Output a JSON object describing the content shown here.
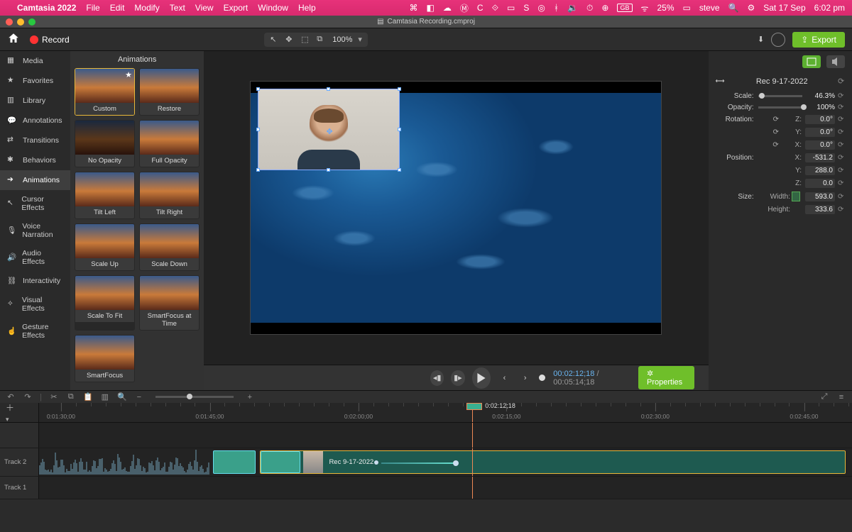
{
  "menubar": {
    "app": "Camtasia 2022",
    "items": [
      "File",
      "Edit",
      "Modify",
      "Text",
      "View",
      "Export",
      "Window",
      "Help"
    ],
    "right": {
      "battery": "25%",
      "user": "steve",
      "date": "Sat 17 Sep",
      "time": "6:02 pm"
    }
  },
  "window": {
    "title": "Camtasia Recording.cmproj"
  },
  "toolbar": {
    "record_label": "Record",
    "zoom": "100%",
    "export_label": "Export"
  },
  "rail": {
    "items": [
      {
        "label": "Media",
        "icon": "film-icon"
      },
      {
        "label": "Favorites",
        "icon": "star-icon"
      },
      {
        "label": "Library",
        "icon": "books-icon"
      },
      {
        "label": "Annotations",
        "icon": "speech-icon"
      },
      {
        "label": "Transitions",
        "icon": "transition-icon"
      },
      {
        "label": "Behaviors",
        "icon": "atom-icon"
      },
      {
        "label": "Animations",
        "icon": "arrow-icon",
        "selected": true
      },
      {
        "label": "Cursor Effects",
        "icon": "cursor-fx-icon"
      },
      {
        "label": "Voice Narration",
        "icon": "mic-icon"
      },
      {
        "label": "Audio Effects",
        "icon": "speaker-icon"
      },
      {
        "label": "Interactivity",
        "icon": "chain-icon"
      },
      {
        "label": "Visual Effects",
        "icon": "magic-icon"
      },
      {
        "label": "Gesture Effects",
        "icon": "hand-icon"
      }
    ]
  },
  "anim_panel": {
    "title": "Animations",
    "tiles": [
      {
        "label": "Custom",
        "selected": true,
        "star": true
      },
      {
        "label": "Restore"
      },
      {
        "label": "No Opacity",
        "dark": true
      },
      {
        "label": "Full Opacity"
      },
      {
        "label": "Tilt Left"
      },
      {
        "label": "Tilt Right"
      },
      {
        "label": "Scale Up"
      },
      {
        "label": "Scale Down"
      },
      {
        "label": "Scale To Fit"
      },
      {
        "label": "SmartFocus at Time"
      },
      {
        "label": "SmartFocus"
      }
    ]
  },
  "playback": {
    "cur": "00:02:12;18",
    "dur": "00:05:14;18",
    "properties_label": "Properties"
  },
  "properties": {
    "clip_name": "Rec 9-17-2022",
    "scale": {
      "label": "Scale:",
      "value": "46.3%",
      "knob": 3
    },
    "opacity": {
      "label": "Opacity:",
      "value": "100%",
      "knob": 96
    },
    "rotation": {
      "label": "Rotation:",
      "z": "0.0°",
      "y": "0.0°",
      "x": "0.0°"
    },
    "position": {
      "label": "Position:",
      "x": "-531.2",
      "y": "288.0",
      "z": "0.0"
    },
    "size": {
      "label": "Size:",
      "width_label": "Width:",
      "width": "593.0",
      "height_label": "Height:",
      "height": "333.6"
    }
  },
  "timeline": {
    "playhead_time": "0:02:12;18",
    "ticks": [
      "0:01:30;00",
      "0:01:45;00",
      "0:02:00;00",
      "0:02:15;00",
      "0:02:30;00",
      "0:02:45;00"
    ],
    "tracks": {
      "t2": "Track 2",
      "t1": "Track 1"
    },
    "clip_label": "Rec 9-17-2022"
  }
}
